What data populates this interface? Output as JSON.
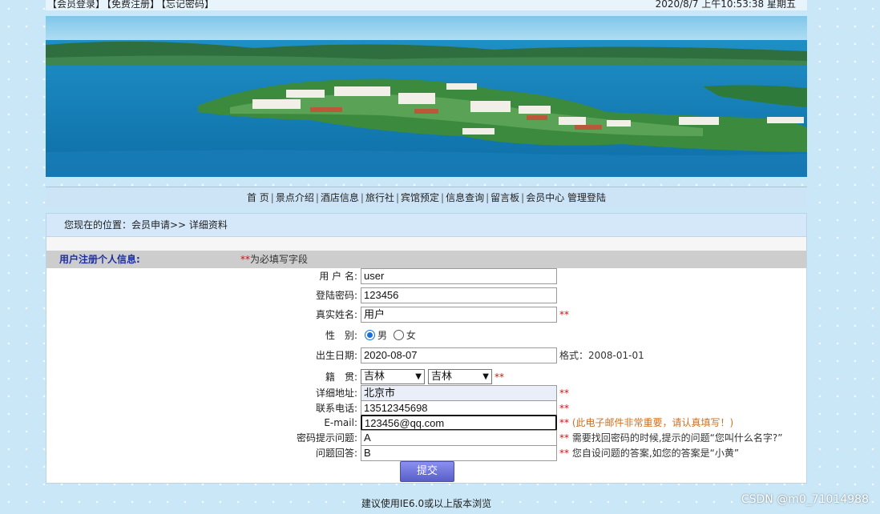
{
  "topbar": {
    "links": [
      "【会员登录】",
      "【免费注册】",
      "【忘记密码】"
    ],
    "datetime": "2020/8/7 上午10:53:38  星期五"
  },
  "nav": {
    "items": [
      "首 页",
      "景点介绍",
      "酒店信息",
      "旅行社",
      "宾馆预定",
      "信息查询",
      "留言板",
      "会员中心",
      "管理登陆"
    ]
  },
  "breadcrumb": "您现在的位置：会员申请>> 详细资料",
  "section": {
    "title": "用户注册个人信息:",
    "required_mark": "**",
    "required_note": "为必填写字段"
  },
  "form": {
    "username": {
      "label": "用 户 名:",
      "value": "user"
    },
    "password": {
      "label": "登陆密码:",
      "value": "123456"
    },
    "realname": {
      "label": "真实姓名:",
      "value": "用户",
      "mark": "**"
    },
    "gender": {
      "label": "性　别:",
      "options": [
        "男",
        "女"
      ],
      "selected": "男"
    },
    "birthday": {
      "label": "出生日期:",
      "value": "2020-08-07",
      "format_hint": "格式：2008-01-01"
    },
    "native": {
      "label": "籍　贯:",
      "province": "吉林",
      "city": "吉林",
      "mark": "**"
    },
    "address": {
      "label": "详细地址:",
      "value": "北京市",
      "mark": "**"
    },
    "phone": {
      "label": "联系电话:",
      "value": "13512345698",
      "mark": "**"
    },
    "email": {
      "label": "E-mail:",
      "value": "123456@qq.com",
      "mark": "**",
      "hint": "(此电子邮件非常重要，请认真填写！)"
    },
    "question": {
      "label": "密码提示问题:",
      "value": "A",
      "mark": "**",
      "hint": "需要找回密码的时候,提示的问题“您叫什么名字?”"
    },
    "answer": {
      "label": "问题回答:",
      "value": "B",
      "mark": "**",
      "hint": "您自设问题的答案,如您的答案是“小黄”"
    },
    "submit_label": "提交"
  },
  "footer": "建议使用IE6.0或以上版本浏览",
  "watermark": "CSDN @m0_71014988",
  "colors": {
    "background": "#c9e7f7",
    "nav": "#cde4f7",
    "section_title": "#1f2fa0",
    "required": "#d01010",
    "submit": "#6a6fd8"
  }
}
